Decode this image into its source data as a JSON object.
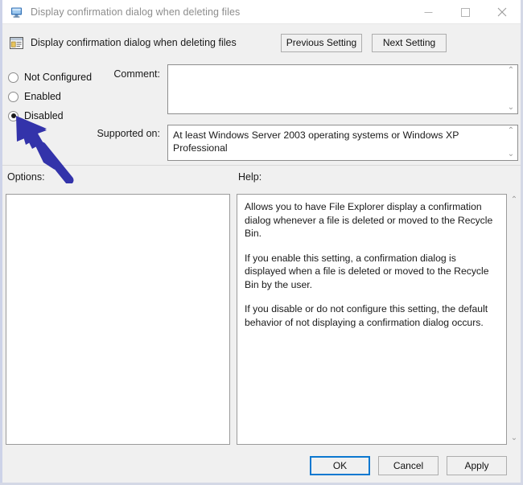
{
  "window": {
    "title": "Display confirmation dialog when deleting files",
    "title_icon": "computer-monitor-icon",
    "controls": {
      "minimize": "—",
      "maximize": "☐",
      "close": "✕"
    }
  },
  "header": {
    "icon": "policy-setting-window-icon",
    "title": "Display confirmation dialog when deleting files",
    "previous_button": "Previous Setting",
    "next_button": "Next Setting"
  },
  "state": {
    "options": [
      {
        "label": "Not Configured",
        "checked": false
      },
      {
        "label": "Enabled",
        "checked": false
      },
      {
        "label": "Disabled",
        "checked": true
      }
    ]
  },
  "fields": {
    "comment_label": "Comment:",
    "comment_value": "",
    "supported_label": "Supported on:",
    "supported_value": "At least Windows Server 2003 operating systems or Windows XP Professional"
  },
  "panels": {
    "options_label": "Options:",
    "options_content": "",
    "help_label": "Help:",
    "help_paragraphs": [
      "Allows you to have File Explorer display a confirmation dialog whenever a file is deleted or moved to the Recycle Bin.",
      "If you enable this setting, a confirmation dialog is displayed when a file is deleted or moved to the Recycle Bin by the user.",
      "If you disable or do not configure this setting, the default behavior of not displaying a confirmation dialog occurs."
    ]
  },
  "footer": {
    "ok_label": "OK",
    "cancel_label": "Cancel",
    "apply_label": "Apply"
  },
  "annotation": {
    "arrow_color": "#3333aa",
    "points_at": "Disabled"
  },
  "scroll_chevrons": {
    "up": "⌃",
    "down": "⌄"
  }
}
